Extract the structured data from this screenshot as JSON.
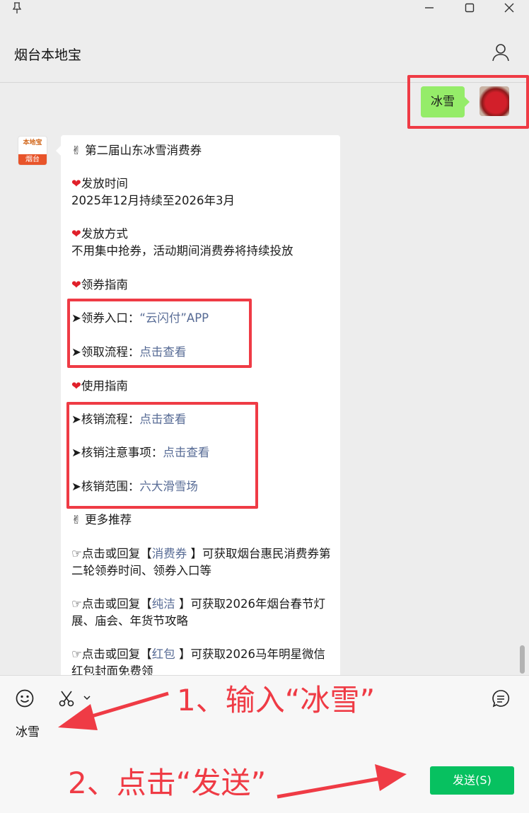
{
  "app": {
    "chat_title": "烟台本地宝"
  },
  "outgoing": {
    "text": "冰雪"
  },
  "bot": {
    "avatar_top": "本地宝",
    "avatar_bottom": "烟台"
  },
  "message": {
    "title": "第二届山东冰雪消费券",
    "sec1_title": "发放时间",
    "sec1_body": "2025年12月持续至2026年3月",
    "sec2_title": "发放方式",
    "sec2_body": "不用集中抢券，活动期间消费券将持续投放",
    "sec3_title": "领券指南",
    "entry_label": "➤领券入口：",
    "entry_link": "“云闪付”APP",
    "flow_label": "➤领取流程：",
    "flow_link": "点击查看",
    "sec4_title": "使用指南",
    "verify_label": "➤核销流程：",
    "verify_link": "点击查看",
    "notice_label": "➤核销注意事项：",
    "notice_link": "点击查看",
    "range_label": "➤核销范围：",
    "range_link": "六大滑雪场",
    "more_title": "更多推荐",
    "rec1_pre": "☞点击或回复【",
    "rec1_link": "消费券",
    "rec1_post": " 】可获取烟台惠民消费券第二轮领券时间、领券入口等",
    "rec2_pre": "☞点击或回复【",
    "rec2_link": "纯洁",
    "rec2_post": " 】可获取2026年烟台春节灯展、庙会、年货节攻略",
    "rec3_pre": "☞点击或回复【",
    "rec3_link": "红包",
    "rec3_post": " 】可获取2026马年明星微信红包封面免费领"
  },
  "input": {
    "value": "冰雪",
    "send_label": "发送(S)"
  },
  "annotations": {
    "step1": "1、输入“冰雪”",
    "step2": "2、点击“发送”"
  },
  "icons": [
    "pin-icon",
    "minimize-icon",
    "maximize-icon",
    "close-icon",
    "profile-icon",
    "emoji-icon",
    "scissors-icon",
    "chevron-down-icon",
    "chat-history-icon",
    "victory-hand-icon",
    "heart-icon"
  ],
  "colors": {
    "accent_green": "#07c160",
    "bubble_green": "#95ec69",
    "link": "#576b95",
    "annotation_red": "#ef3b45"
  }
}
